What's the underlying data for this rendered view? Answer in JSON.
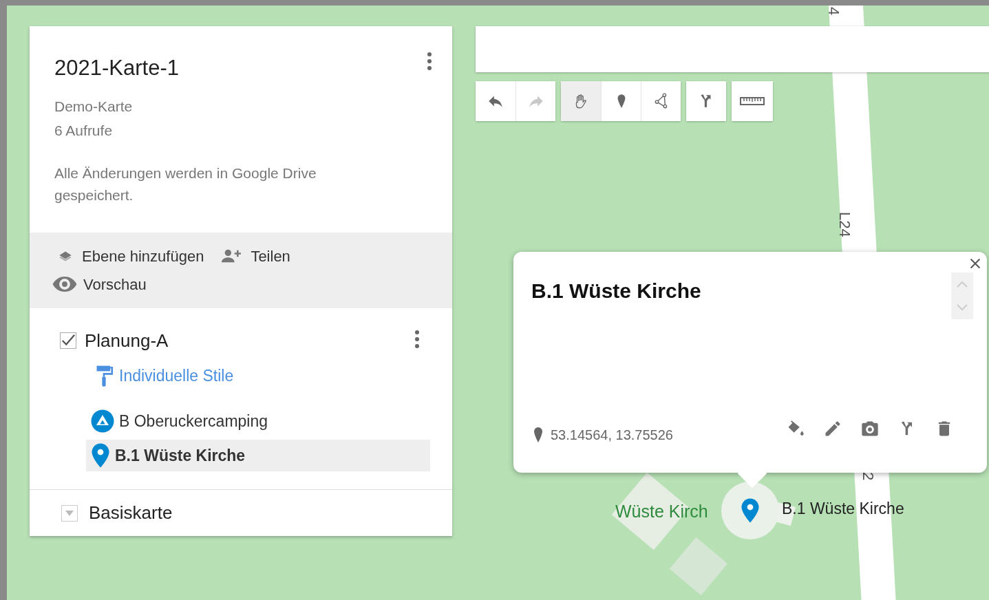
{
  "map_panel": {
    "title": "2021-Karte-1",
    "description": "Demo-Karte",
    "views": "6 Aufrufe",
    "save_status": "Alle Änderungen werden in Google Drive gespeichert.",
    "actions": [
      {
        "kind": "add-layer",
        "label": "Ebene hinzufügen"
      },
      {
        "kind": "share",
        "label": "Teilen"
      },
      {
        "kind": "preview",
        "label": "Vorschau"
      }
    ],
    "layers": [
      {
        "name": "Planung-A",
        "checked": true,
        "style_link": "Individuelle Stile",
        "items": [
          {
            "kind": "camping",
            "name": "B Oberuckercamping",
            "selected": false
          },
          {
            "kind": "pin",
            "name": "B.1 Wüste Kirche",
            "selected": true
          }
        ]
      }
    ],
    "base_map": {
      "label": "Basiskarte",
      "expanded": false
    }
  },
  "toolbar": {
    "groups": [
      [
        {
          "kind": "undo",
          "disabled": false
        },
        {
          "kind": "redo",
          "disabled": true
        }
      ],
      [
        {
          "kind": "hand",
          "selected": true
        },
        {
          "kind": "marker",
          "selected": false
        },
        {
          "kind": "line",
          "selected": false
        }
      ],
      [
        {
          "kind": "route",
          "selected": false
        }
      ],
      [
        {
          "kind": "measure",
          "selected": false
        }
      ]
    ]
  },
  "popup": {
    "title": "B.1 Wüste Kirche",
    "coordinates": "53.14564, 13.75526",
    "actions": [
      {
        "kind": "style"
      },
      {
        "kind": "edit"
      },
      {
        "kind": "photo"
      },
      {
        "kind": "directions"
      },
      {
        "kind": "delete"
      }
    ]
  },
  "map_labels": [
    {
      "kind": "road",
      "text": "4"
    },
    {
      "kind": "road",
      "text": "L24"
    },
    {
      "kind": "road",
      "text": "2"
    },
    {
      "kind": "place",
      "text": "Wüste Kirch"
    },
    {
      "kind": "marker",
      "text": "B.1 Wüste Kirche"
    }
  ]
}
